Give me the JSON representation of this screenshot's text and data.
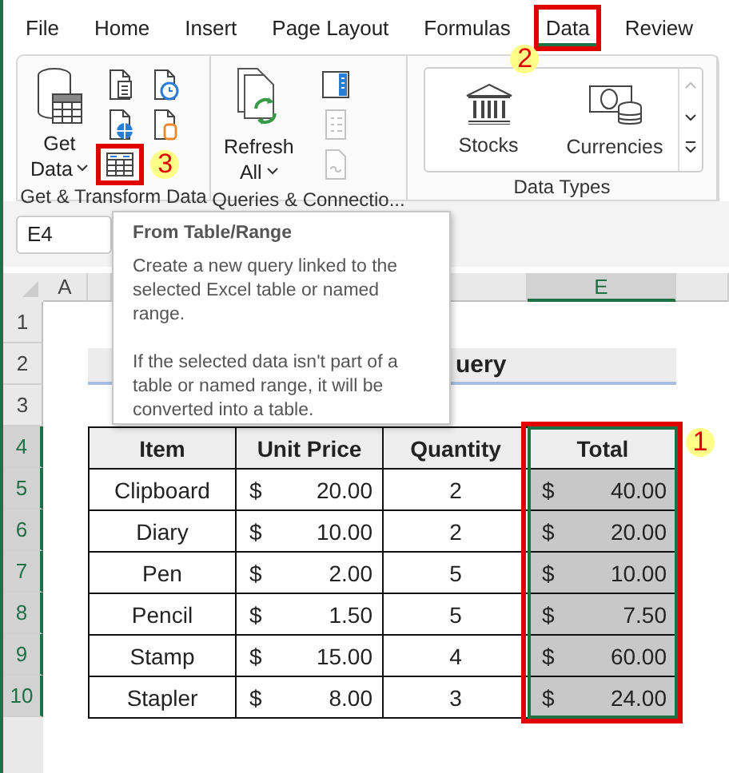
{
  "tabs": [
    {
      "label": "File",
      "selected": false
    },
    {
      "label": "Home",
      "selected": false
    },
    {
      "label": "Insert",
      "selected": false
    },
    {
      "label": "Page Layout",
      "selected": false
    },
    {
      "label": "Formulas",
      "selected": false
    },
    {
      "label": "Data",
      "selected": true,
      "highlighted": true,
      "callout": "2"
    },
    {
      "label": "Review",
      "selected": false
    }
  ],
  "ribbon": {
    "groups": [
      {
        "kind": "get-transform",
        "label": "Get & Transform Data",
        "large": {
          "lines": [
            "Get",
            "Data"
          ]
        },
        "small": [
          {
            "disabled": false
          },
          {
            "disabled": false
          },
          {
            "disabled": false
          },
          {
            "disabled": false
          },
          {
            "disabled": false,
            "highlighted": true,
            "callout": "3"
          }
        ]
      },
      {
        "kind": "queries",
        "label": "Queries & Connectio...",
        "large": {
          "lines": [
            "Refresh",
            "All"
          ]
        },
        "small": [
          {
            "disabled": false
          },
          {
            "disabled": true
          },
          {
            "disabled": true
          }
        ]
      },
      {
        "kind": "data-types",
        "label": "Data Types",
        "gallery": [
          "Stocks",
          "Currencies"
        ]
      }
    ]
  },
  "name_box": "E4",
  "tooltip": {
    "title": "From Table/Range",
    "paragraphs": [
      "Create a new query linked to the selected Excel table or named range.",
      "If the selected data isn't part of a table or named range, it will be converted into a table."
    ]
  },
  "sheet": {
    "column_headers": [
      {
        "label": "A",
        "selected": false
      },
      {
        "label": "E",
        "selected": true
      }
    ],
    "row_headers": [
      {
        "label": "1",
        "selected": false
      },
      {
        "label": "2",
        "selected": false
      },
      {
        "label": "3",
        "selected": false
      },
      {
        "label": "4",
        "selected": true
      },
      {
        "label": "5",
        "selected": true
      },
      {
        "label": "6",
        "selected": true
      },
      {
        "label": "7",
        "selected": true
      },
      {
        "label": "8",
        "selected": true
      },
      {
        "label": "9",
        "selected": true
      },
      {
        "label": "10",
        "selected": true
      }
    ],
    "title": "uery",
    "table": {
      "columns": [
        {
          "label": "Item",
          "selected": false
        },
        {
          "label": "Unit Price",
          "selected": false
        },
        {
          "label": "Quantity",
          "selected": false
        },
        {
          "label": "Total",
          "selected": true,
          "highlighted": true,
          "callout": "1"
        }
      ],
      "rows": [
        [
          {
            "text": "Clipboard"
          },
          {
            "currency": "$",
            "amount": "20.00"
          },
          {
            "text": "2"
          },
          {
            "currency": "$",
            "amount": "40.00"
          }
        ],
        [
          {
            "text": "Diary"
          },
          {
            "currency": "$",
            "amount": "10.00"
          },
          {
            "text": "2"
          },
          {
            "currency": "$",
            "amount": "20.00"
          }
        ],
        [
          {
            "text": "Pen"
          },
          {
            "currency": "$",
            "amount": "2.00"
          },
          {
            "text": "5"
          },
          {
            "currency": "$",
            "amount": "10.00"
          }
        ],
        [
          {
            "text": "Pencil"
          },
          {
            "currency": "$",
            "amount": "1.50"
          },
          {
            "text": "5"
          },
          {
            "currency": "$",
            "amount": "7.50"
          }
        ],
        [
          {
            "text": "Stamp"
          },
          {
            "currency": "$",
            "amount": "15.00"
          },
          {
            "text": "4"
          },
          {
            "currency": "$",
            "amount": "60.00"
          }
        ],
        [
          {
            "text": "Stapler"
          },
          {
            "currency": "$",
            "amount": "8.00"
          },
          {
            "text": "3"
          },
          {
            "currency": "$",
            "amount": "24.00"
          }
        ]
      ]
    }
  }
}
